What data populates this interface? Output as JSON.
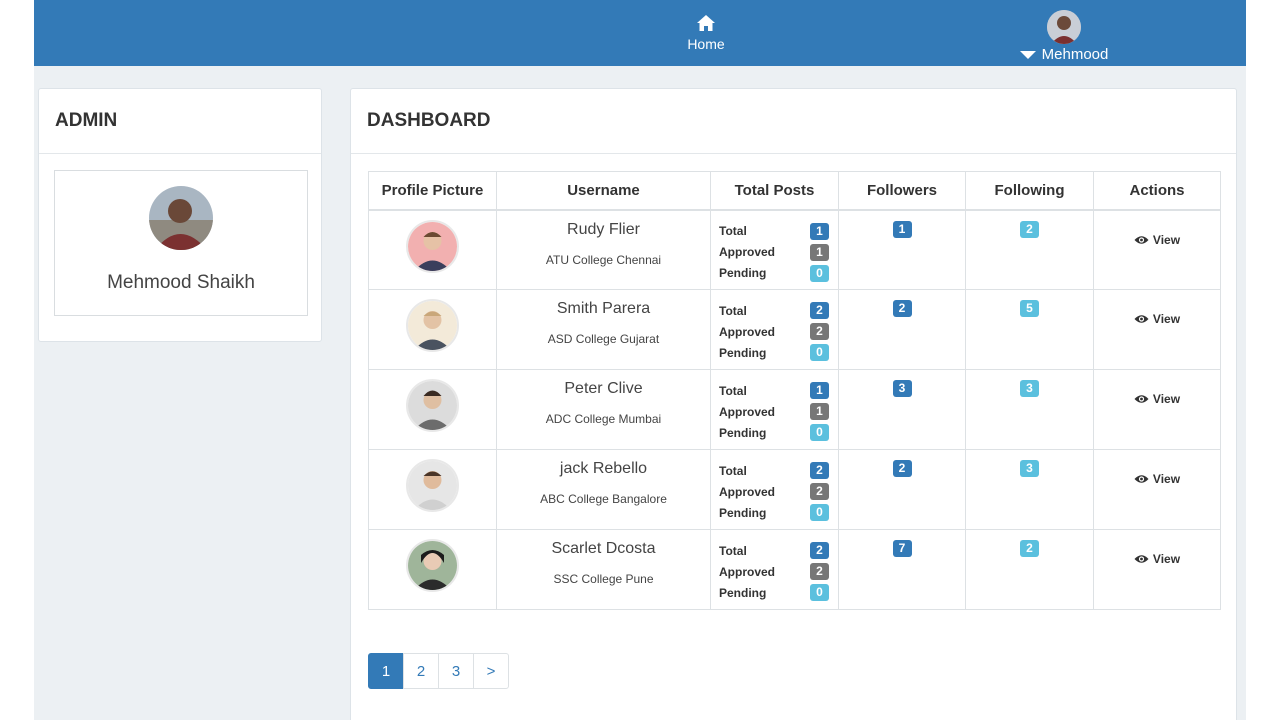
{
  "navbar": {
    "home_label": "Home",
    "user_label": "Mehmood"
  },
  "admin_panel": {
    "title": "ADMIN",
    "name": "Mehmood Shaikh"
  },
  "dashboard": {
    "title": "DASHBOARD",
    "columns": [
      "Profile Picture",
      "Username",
      "Total Posts",
      "Followers",
      "Following",
      "Actions"
    ],
    "post_labels": {
      "total": "Total",
      "approved": "Approved",
      "pending": "Pending"
    },
    "view_label": "View",
    "rows": [
      {
        "name": "Rudy Flier",
        "college": "ATU College Chennai",
        "total": "1",
        "approved": "1",
        "pending": "0",
        "followers": "1",
        "following": "2"
      },
      {
        "name": "Smith Parera",
        "college": "ASD College Gujarat",
        "total": "2",
        "approved": "2",
        "pending": "0",
        "followers": "2",
        "following": "5"
      },
      {
        "name": "Peter Clive",
        "college": "ADC College Mumbai",
        "total": "1",
        "approved": "1",
        "pending": "0",
        "followers": "3",
        "following": "3"
      },
      {
        "name": "jack Rebello",
        "college": "ABC College Bangalore",
        "total": "2",
        "approved": "2",
        "pending": "0",
        "followers": "2",
        "following": "3"
      },
      {
        "name": "Scarlet Dcosta",
        "college": "SSC College Pune",
        "total": "2",
        "approved": "2",
        "pending": "0",
        "followers": "7",
        "following": "2"
      }
    ]
  },
  "pagination": {
    "pages": [
      "1",
      "2",
      "3"
    ],
    "next": ">",
    "active": "1"
  },
  "colors": {
    "primary": "#337ab7",
    "approved": "#777777",
    "pending": "#5bc0de",
    "background": "#ecf0f3"
  }
}
